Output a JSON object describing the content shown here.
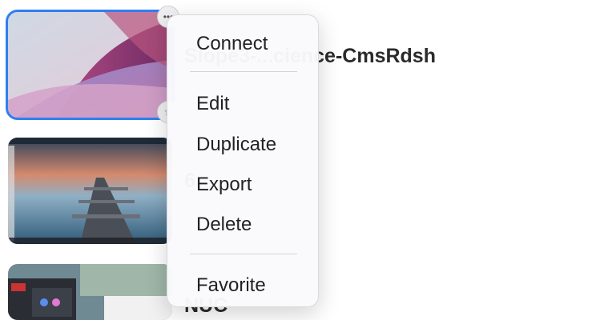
{
  "connections": [
    {
      "name": "Slope3-...cience-CmsRdsh",
      "selected": true
    },
    {
      "name": "6",
      "selected": false
    },
    {
      "name": "NUC",
      "selected": false
    }
  ],
  "context_menu": {
    "items": [
      {
        "label": "Connect"
      },
      {
        "label": "Edit"
      },
      {
        "label": "Duplicate"
      },
      {
        "label": "Export"
      },
      {
        "label": "Delete"
      },
      {
        "label": "Favorite"
      }
    ]
  },
  "colors": {
    "selection": "#2f7ff0",
    "menu_background": "#fafafc"
  },
  "icons": {
    "more": "ellipsis-icon",
    "favorite": "star-icon"
  }
}
